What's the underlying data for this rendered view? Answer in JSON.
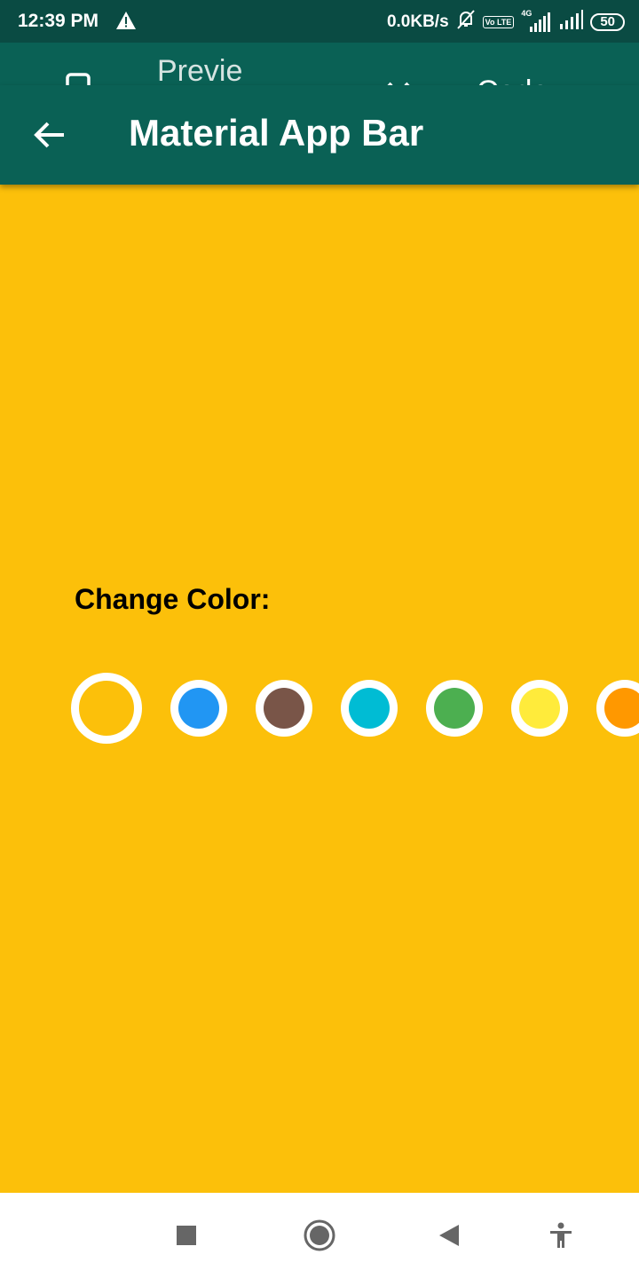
{
  "status_bar": {
    "time": "12:39 PM",
    "network_speed": "0.0KB/s",
    "volte_badge": "Vo LTE",
    "signal_badge": "4G",
    "battery": "50"
  },
  "tabs": {
    "preview_label": "Preview",
    "code_label": "Code"
  },
  "app_bar": {
    "title": "Material App Bar",
    "color": "#0a6155"
  },
  "content": {
    "background_color": "#fcc00a",
    "change_color_label": "Change Color:",
    "swatches": [
      {
        "name": "amber",
        "color": "#fcc00a",
        "selected": true
      },
      {
        "name": "blue",
        "color": "#2196f3",
        "selected": false
      },
      {
        "name": "brown",
        "color": "#795548",
        "selected": false
      },
      {
        "name": "cyan",
        "color": "#00bcd4",
        "selected": false
      },
      {
        "name": "green",
        "color": "#4caf50",
        "selected": false
      },
      {
        "name": "yellow",
        "color": "#ffeb3b",
        "selected": false
      },
      {
        "name": "orange",
        "color": "#ff9800",
        "selected": false
      }
    ]
  },
  "nav_bar": {
    "icons": [
      "recent-apps-icon",
      "home-icon",
      "back-triangle-icon",
      "accessibility-icon"
    ]
  }
}
